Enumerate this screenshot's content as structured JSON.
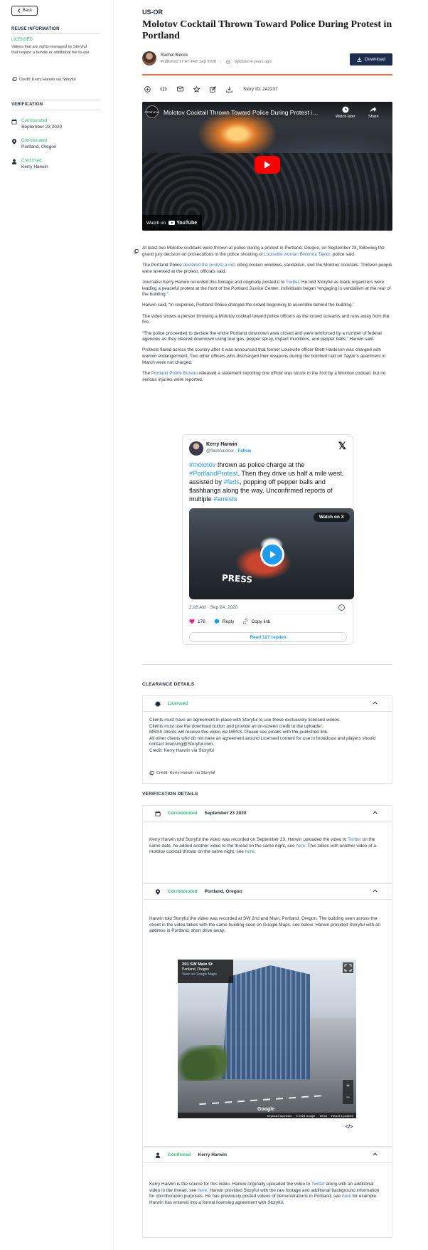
{
  "sidebar": {
    "back_label": "Back",
    "reuse_heading": "REUSE INFORMATION",
    "reuse_status": "LICENSED",
    "reuse_description": "Videos that are rights-managed by Storyful that require a bundle or additional fee to use",
    "credit": "Credit: Kerry Harwin via Storyful",
    "verification_heading": "VERIFICATION",
    "verification": [
      {
        "status": "Corroborated",
        "value": "September 23 2020",
        "icon": "calendar-icon"
      },
      {
        "status": "Corroborated",
        "value": "Portland, Oregon",
        "icon": "location-pin-icon"
      },
      {
        "status": "Confirmed",
        "value": "Kerry Harwin",
        "icon": "person-icon"
      }
    ]
  },
  "article": {
    "region": "US-OR",
    "title": "Molotov Cocktail Thrown Toward Police During Protest in Portland",
    "author": "Rachel Bidock",
    "published": "Published 17:47 24th Sep 2020",
    "updated": "Updated 4 years ago",
    "download_label": "Download",
    "story_id": "Story ID: 242237"
  },
  "video": {
    "title": "Molotov Cocktail Thrown Toward Police During Protest in...",
    "channel_logo": "STORYFUL",
    "watch_later": "Watch later",
    "share": "Share",
    "watch_on": "Watch on",
    "platform": "YouTube"
  },
  "body": {
    "p1_a": "At least two Molotov cocktails were thrown at police during a protest in Portland, Oregon, on September 23, following the grand jury decision on prosecutions in the police shooting of ",
    "p1_link": "Louisville woman Breonna Taylor",
    "p1_b": ", police said.",
    "p2_a": "The Portland Police ",
    "p2_link": "declared the protest a riot",
    "p2_b": ", citing broken windows, vandalism, and the Molotov cocktails. Thirteen people were arrested at the protest, officials said.",
    "p3_a": "Journalist Kerry Harwin recorded this footage and originally posted it to ",
    "p3_link": "Twitter",
    "p3_b": ". He told Storyful as black organizers were leading a peaceful protest at the front of the Portland Justice Center, individuals began “engaging in vandalism at the rear of the building.”",
    "p4": "Harwin said, “In response, Portland Police charged the crowd beginning to assemble behind the building.”",
    "p5": "The video shows a person throwing a Molotov cocktail toward police officers as the crowd screams and runs away from the fire.",
    "p6": "“The police proceeded to declare the entire Portland downtown area closed and were reinforced by a number of federal agencies as they cleared downtown using tear gas, pepper spray, impact munitions, and pepper balls,” Harwin said.",
    "p7": "Protests flared across the country after it was announced that former Louisville officer Brett Hankison was charged with wanton endangerment. Two other officers who discharged their weapons during the botched raid on Taylor’s apartment in March were not charged.",
    "p8_a": "The ",
    "p8_link": "Portland Police Bureau",
    "p8_b": " released a statement reporting one officer was struck in the foot by a Molotov cocktail, but no serious injuries were reported."
  },
  "tweet": {
    "name": "Kerry Harwin",
    "handle": "@flashhardcor",
    "follow": "Follow",
    "h1": "#molotov",
    "t1": " thrown as police charge at the ",
    "h2": "#PortlandProtest",
    "t2": ". Then they drive us half a mile west, assisted by ",
    "h3": "#feds",
    "t3": ", popping off pepper balls and flashbangs along the way. Unconfirmed reports of multiple ",
    "h4": "#arrests",
    "press_text": "PRESS",
    "watch_on_x": "Watch on X",
    "timestamp": "2:28 AM · Sep 24, 2020",
    "likes": "176",
    "reply": "Reply",
    "copy_link": "Copy link",
    "read_replies": "Read 127 replies"
  },
  "clearance": {
    "heading": "CLEARANCE DETAILS",
    "status": "Licensed",
    "lines": [
      "Clients must have an agreement in place with Storyful to use these exclusively licensed videos.",
      "Clients must use the download button and provide an on-screen credit to the uploader.",
      "MRSS clients will receive this video via MRSS. Please see emails with the published link.",
      "All other clients who do not have an agreement around Licensed content for use in broadcast and players should contact licensing@Storyful.com.",
      "Credit: Kerry Harwin via Storyful"
    ],
    "credit": "Credit: Kerry Harwin via Storyful"
  },
  "verification_details": {
    "heading": "VERIFICATION DETAILS",
    "date": {
      "status": "Corroborated",
      "value": "September 23 2020",
      "text_a": "Kerry Harwin told Storyful the video was recorded on September 23. Harwin uploaded the video to ",
      "link1": "Twitter",
      "text_b": " on the same date, he added another video to the thread on the same night, see ",
      "link2": "here",
      "text_c": ". This tallies with another video of a molotov cocktail thrown on the same night, see ",
      "link3": "here",
      "text_d": "."
    },
    "location": {
      "status": "Corroborated",
      "value": "Portland, Oregon",
      "text": "Harwin told Storyful the video was recorded at SW 2nd and Main, Portland, Oregon. The building seen across the street in the video tallies with the same building seen on Google Maps, see below. Harwin provided Storyful with an address in Portland, short drive away."
    },
    "map": {
      "address": "201 SW Main St",
      "city": "Portland, Oregon",
      "view_link": "View on Google Maps",
      "brand": "Google",
      "footer": [
        "Keyboard shortcuts",
        "© 2025 Google",
        "Terms",
        "Report a problem"
      ],
      "embed_label": "</>"
    },
    "source": {
      "status": "Confirmed",
      "value": "Kerry Harwin",
      "text_a": "Kerry Harwin is the source for this video. Harwin originally uploaded the video to ",
      "link1": "Twitter",
      "text_b": " along with an additional video in the thread, see ",
      "link2": "here",
      "text_c": ". Harwin provided Storyful with the raw footage and additional background information for corroboration purposes. He has previously posted videos of demonstrations in Portland, see ",
      "link3": "here",
      "text_d": " for example. Harwin has entered into a formal licensing agreement with Storyful."
    }
  },
  "colors": {
    "accent_orange": "#e8703a",
    "status_green": "#2fbf71",
    "link_blue": "#3a78d6",
    "button_navy": "#1c2d4d"
  }
}
